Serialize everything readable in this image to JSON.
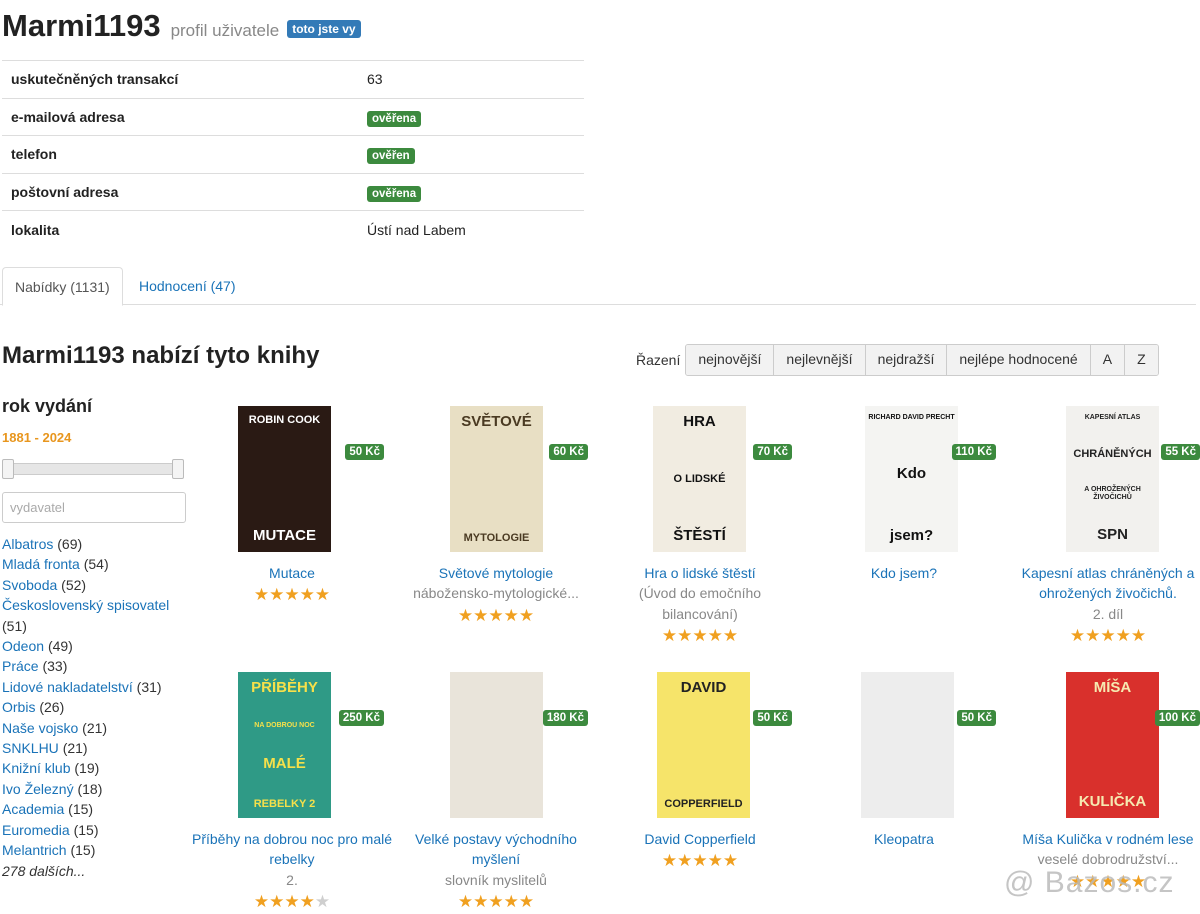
{
  "profile": {
    "username": "Marmi1193",
    "subtitle": "profil uživatele",
    "you_badge": "toto jste vy",
    "rows": [
      {
        "key": "uskutečněných transakcí",
        "value": "63",
        "badge": false
      },
      {
        "key": "e-mailová adresa",
        "value": "ověřena",
        "badge": true
      },
      {
        "key": "telefon",
        "value": "ověřen",
        "badge": true
      },
      {
        "key": "poštovní adresa",
        "value": "ověřena",
        "badge": true
      },
      {
        "key": "lokalita",
        "value": "Ústí nad Labem",
        "badge": false
      }
    ]
  },
  "tabs": [
    {
      "label": "Nabídky (1131)",
      "active": true
    },
    {
      "label": "Hodnocení (47)",
      "active": false
    }
  ],
  "offers": {
    "title": "Marmi1193 nabízí tyto knihy"
  },
  "sort": {
    "label": "Řazení",
    "options": [
      "nejnovější",
      "nejlevnější",
      "nejdražší",
      "nejlépe hodnocené",
      "A",
      "Z"
    ]
  },
  "filters": {
    "year_title": "rok vydání",
    "year_range": "1881 - 2024",
    "year_min": 1881,
    "year_max": 2024,
    "publisher_placeholder": "vydavatel",
    "publishers": [
      {
        "name": "Albatros",
        "count": "(69)"
      },
      {
        "name": "Mladá fronta",
        "count": "(54)"
      },
      {
        "name": "Svoboda",
        "count": "(52)"
      },
      {
        "name": "Československý spisovatel",
        "count": "(51)"
      },
      {
        "name": "Odeon",
        "count": "(49)"
      },
      {
        "name": "Práce",
        "count": "(33)"
      },
      {
        "name": "Lidové nakladatelství",
        "count": "(31)"
      },
      {
        "name": "Orbis",
        "count": "(26)"
      },
      {
        "name": "Naše vojsko",
        "count": "(21)"
      },
      {
        "name": "SNKLHU",
        "count": "(21)"
      },
      {
        "name": "Knižní klub",
        "count": "(19)"
      },
      {
        "name": "Ivo Železný",
        "count": "(18)"
      },
      {
        "name": "Academia",
        "count": "(15)"
      },
      {
        "name": "Euromedia",
        "count": "(15)"
      },
      {
        "name": "Melantrich",
        "count": "(15)"
      }
    ],
    "more": "278 dalších..."
  },
  "books": [
    {
      "title": "Mutace",
      "subtitle": "",
      "price": "50 Kč",
      "rating": 5,
      "cover_text": "ROBIN COOK|MUTACE",
      "cover_color": "#2a1a14",
      "cover_fg": "#ffffff"
    },
    {
      "title": "Světové mytologie",
      "subtitle": "nábožensko-mytologické...",
      "price": "60 Kč",
      "rating": 5,
      "cover_text": "SVĚTOVÉ|MYTOLOGIE",
      "cover_color": "#e8dfc4",
      "cover_fg": "#4a3a22"
    },
    {
      "title": "Hra o lidské štěstí",
      "subtitle": "(Úvod do emočního bilancování)",
      "price": "70 Kč",
      "rating": 5,
      "cover_text": "HRA|O LIDSKÉ|ŠTĚSTÍ",
      "cover_color": "#f1ece1",
      "cover_fg": "#111111"
    },
    {
      "title": "Kdo jsem?",
      "subtitle": "",
      "price": "110 Kč",
      "rating": 0,
      "cover_text": "RICHARD DAVID PRECHT|Kdo|jsem?",
      "cover_color": "#f4f4f2",
      "cover_fg": "#111111"
    },
    {
      "title": "Kapesní atlas chráněných a ohrožených živočichů.",
      "subtitle": "2. díl",
      "price": "55 Kč",
      "rating": 5,
      "cover_text": "KAPESNÍ ATLAS|CHRÁNĚNÝCH|A OHROŽENÝCH ŽIVOČICHŮ|SPN",
      "cover_color": "#f2f1ee",
      "cover_fg": "#222222"
    },
    {
      "title": "Příběhy na dobrou noc pro malé rebelky",
      "subtitle": "2.",
      "price": "250 Kč",
      "rating": 4,
      "cover_text": "PŘÍBĚHY|NA DOBROU NOC|MALÉ|REBELKY 2",
      "cover_color": "#2f9a86",
      "cover_fg": "#f6e04a"
    },
    {
      "title": "Velké postavy východního myšlení",
      "subtitle": "slovník myslitelů",
      "price": "180 Kč",
      "rating": 4.5,
      "cover_text": "",
      "cover_color": "#e9e4da",
      "cover_fg": "#444444"
    },
    {
      "title": "David Copperfield",
      "subtitle": "",
      "price": "50 Kč",
      "rating": 5,
      "cover_text": "DAVID|COPPERFIELD",
      "cover_color": "#f6e46a",
      "cover_fg": "#222222"
    },
    {
      "title": "Kleopatra",
      "subtitle": "",
      "price": "50 Kč",
      "rating": 0,
      "cover_text": "",
      "cover_color": "#ededed",
      "cover_fg": "#ededed"
    },
    {
      "title": "Míša Kulička v rodném lese",
      "subtitle": "veselé dobrodružství...",
      "price": "100 Kč",
      "rating": 5,
      "cover_text": "MÍŠA|KULIČKA",
      "cover_color": "#d9302c",
      "cover_fg": "#f6e9b0"
    }
  ],
  "watermark": "@ Bazos.cz"
}
